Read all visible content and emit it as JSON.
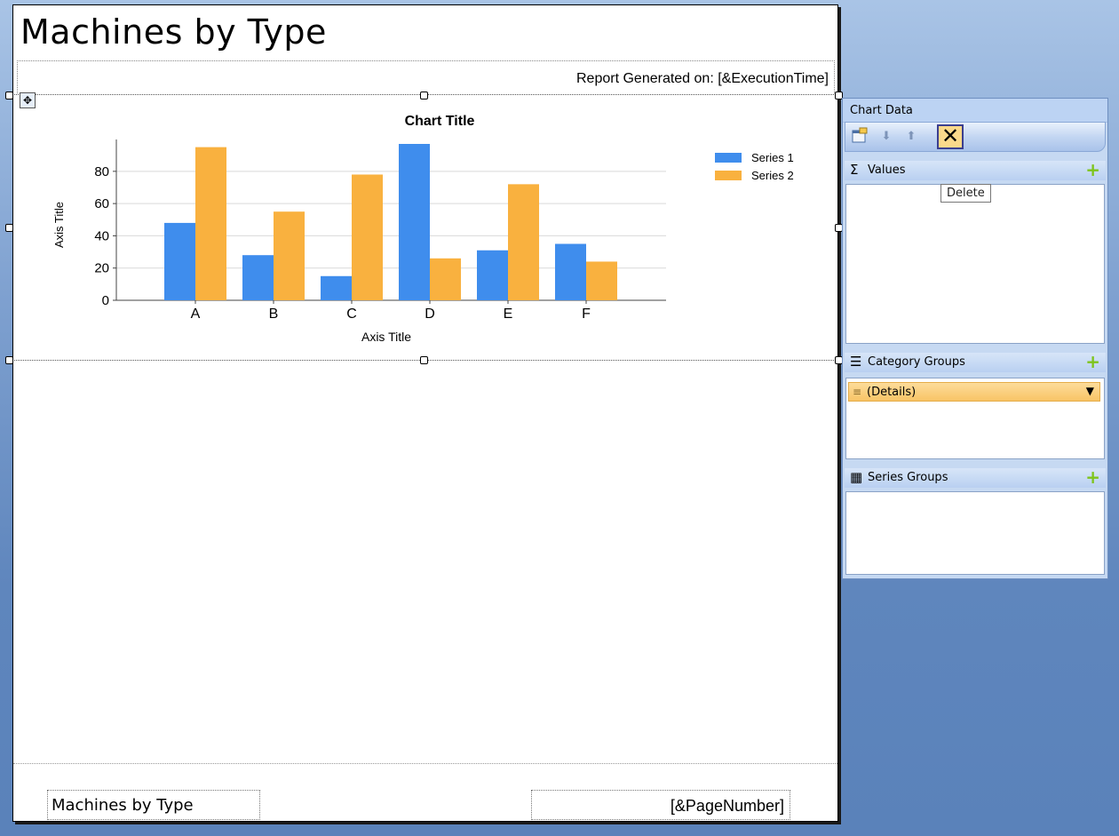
{
  "report": {
    "title": "Machines by Type",
    "generated_label": "Report Generated on: [&ExecutionTime]",
    "footer_left": "Machines by Type",
    "footer_right": "[&PageNumber]"
  },
  "chart_data": {
    "type": "bar",
    "title": "Chart Title",
    "xlabel": "Axis Title",
    "ylabel": "Axis Title",
    "categories": [
      "A",
      "B",
      "C",
      "D",
      "E",
      "F"
    ],
    "series": [
      {
        "name": "Series 1",
        "values": [
          48,
          28,
          15,
          97,
          31,
          35
        ],
        "color": "#3f8ded"
      },
      {
        "name": "Series 2",
        "values": [
          95,
          55,
          78,
          26,
          72,
          24
        ],
        "color": "#f9b13f"
      }
    ],
    "ylim": [
      0,
      97
    ],
    "yticks": [
      0,
      20,
      40,
      60,
      80
    ],
    "grid": true,
    "legend": "top-right"
  },
  "panel": {
    "title": "Chart Data",
    "values_label": "Values",
    "category_groups_label": "Category Groups",
    "series_groups_label": "Series Groups",
    "details_label": "(Details)",
    "tooltip": "Delete"
  },
  "colors": {
    "accent_orange": "#f9b13f",
    "accent_blue": "#3f8ded",
    "panel_bg": "#c6d9f2"
  }
}
